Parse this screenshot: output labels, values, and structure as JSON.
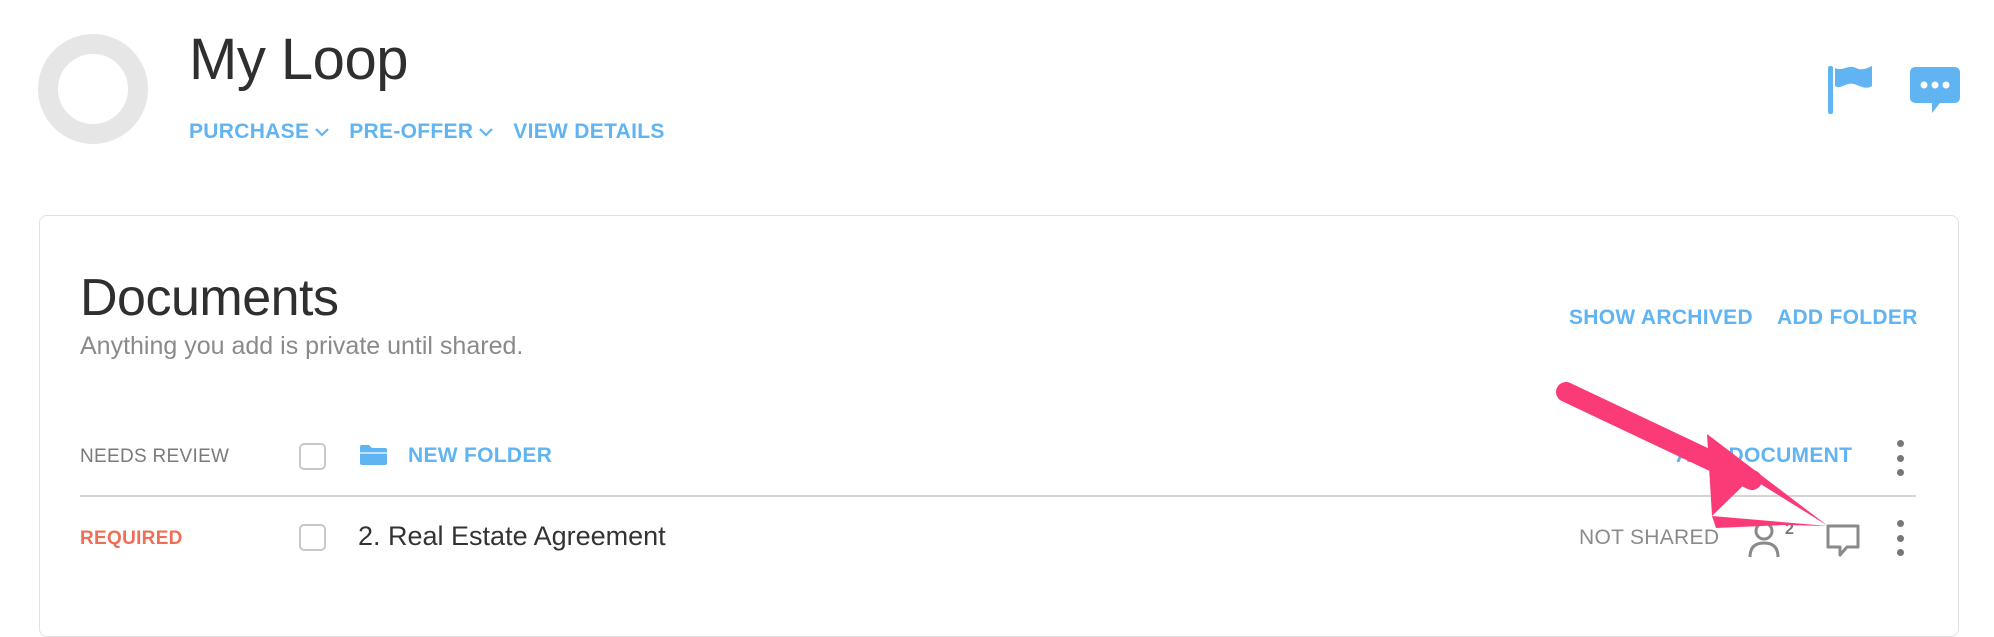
{
  "loop": {
    "title": "My Loop",
    "nav": [
      {
        "label": "PURCHASE",
        "has_dropdown": true
      },
      {
        "label": "PRE-OFFER",
        "has_dropdown": true
      },
      {
        "label": "VIEW DETAILS",
        "has_dropdown": false
      }
    ]
  },
  "header_icons": [
    "flag-icon",
    "chat-bubble-icon"
  ],
  "documents": {
    "title": "Documents",
    "subtitle": "Anything you add is private until shared.",
    "actions": {
      "show_archived": "SHOW ARCHIVED",
      "add_folder": "ADD FOLDER"
    },
    "section": {
      "label": "NEEDS REVIEW",
      "new_folder": "NEW FOLDER",
      "add_document": "ADD DOCUMENT"
    },
    "rows": [
      {
        "status": "REQUIRED",
        "name": "2. Real Estate Agreement",
        "share_status": "NOT SHARED",
        "people_count": "2"
      }
    ]
  },
  "colors": {
    "accent": "#60b4f2",
    "required": "#ef6f56",
    "annotation_arrow": "#fb3a78"
  }
}
